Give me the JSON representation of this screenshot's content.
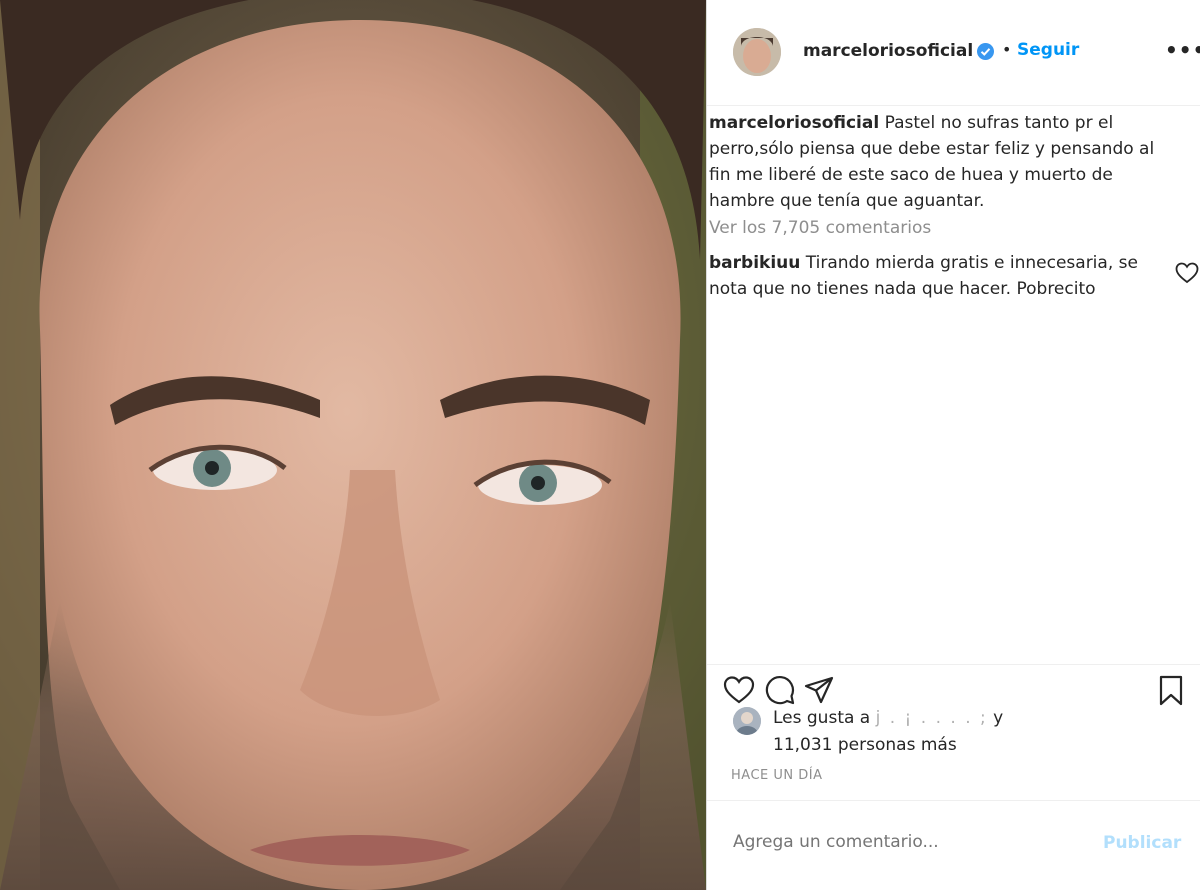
{
  "post": {
    "image_subject": "",
    "author": "marceloriosoficial",
    "verified": true,
    "follow_label": "Seguir",
    "separator": "•",
    "more_label": "•••"
  },
  "caption": {
    "user": "marceloriosoficial",
    "text": "Pastel no sufras tanto pr el perro,sólo piensa que debe estar feliz y pensando al fin me liberé de este saco de huea y muerto de hambre que tenía que aguantar."
  },
  "view_comments": "Ver los 7,705 comentarios",
  "comments": [
    {
      "user": "barbikiuu",
      "text": "Tirando mierda gratis e innecesaria, se nota que no tienes nada que hacer. Pobrecito"
    }
  ],
  "likes": {
    "prefix": "Les gusta a",
    "names_redacted": "j . ¡ . . . . ;",
    "connector": "y",
    "count_text": "11,031 personas más"
  },
  "timestamp": "HACE UN DÍA",
  "comment_box": {
    "placeholder": "Agrega un comentario...",
    "publish_label": "Publicar"
  },
  "colors": {
    "accent": "#0095f6",
    "publish_disabled": "#b2dffc",
    "muted": "#8e8e8e",
    "text": "#262626",
    "verified": "#3897f0"
  },
  "icons": {
    "like": "heart-icon",
    "comment": "comment-bubble-icon",
    "share": "paper-plane-icon",
    "save": "bookmark-icon",
    "verified": "verified-badge-icon",
    "comment_like": "heart-icon"
  }
}
